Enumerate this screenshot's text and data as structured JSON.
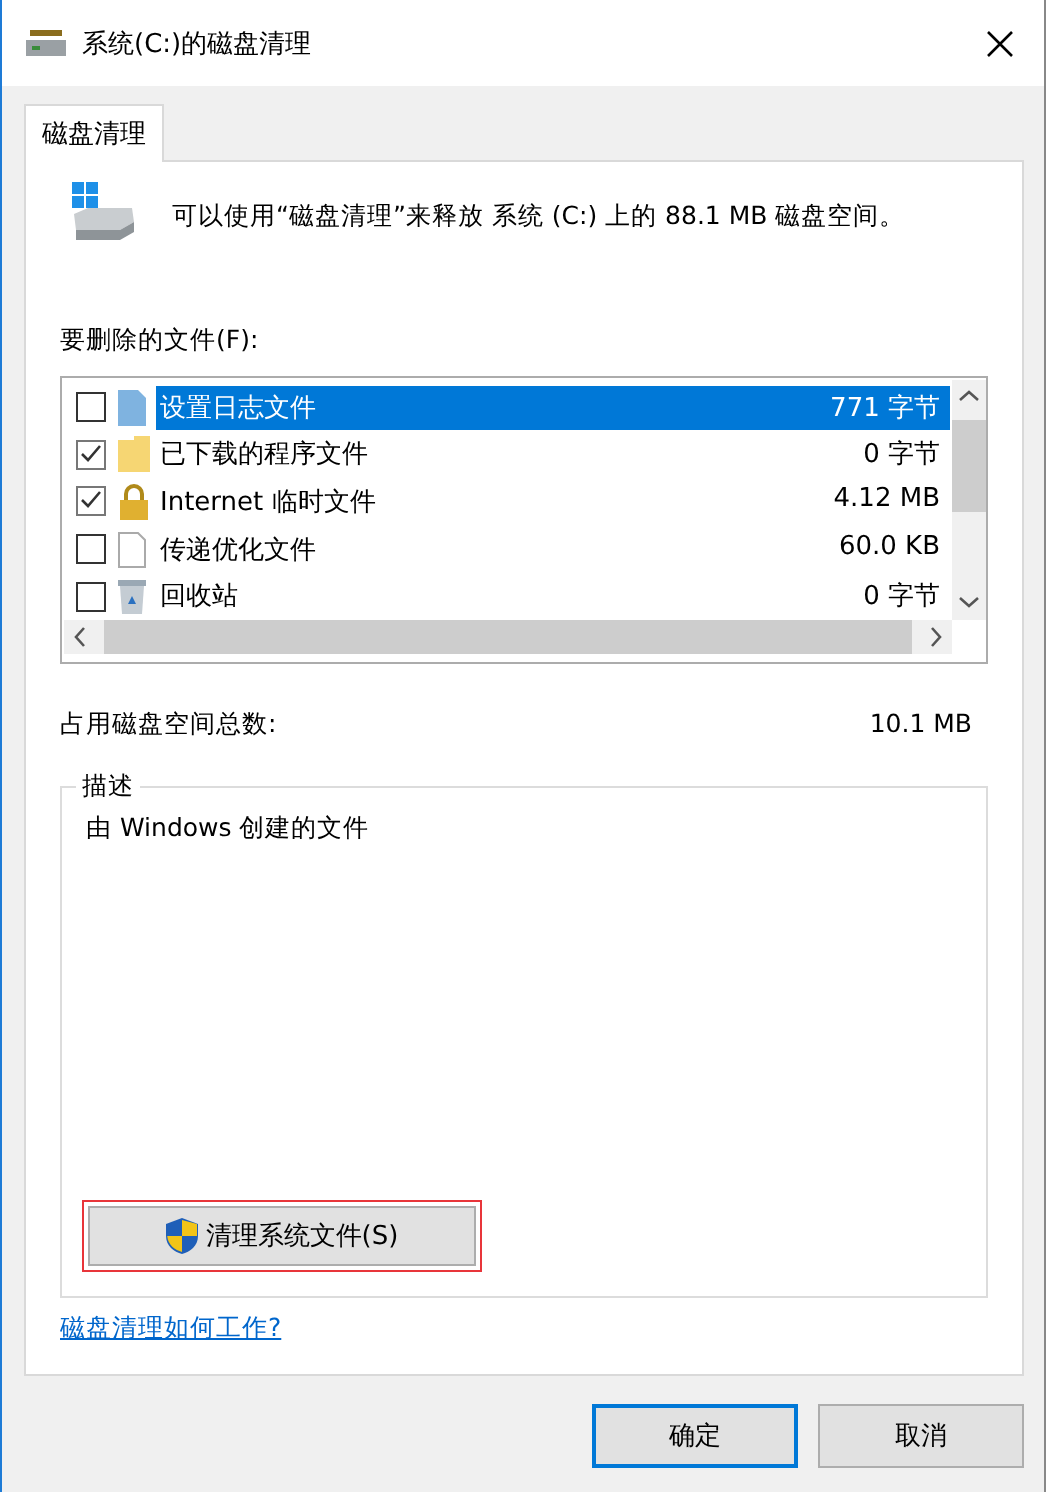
{
  "window": {
    "title": "系统(C:)的磁盘清理"
  },
  "tabs": [
    {
      "label": "磁盘清理",
      "selected": true
    }
  ],
  "intro": "可以使用“磁盘清理”来释放 系统 (C:) 上的 88.1 MB 磁盘空间。",
  "files_label": "要删除的文件(F):",
  "files": [
    {
      "name": "设置日志文件",
      "size": "771 字节",
      "checked": false,
      "selected": true,
      "kind": "log"
    },
    {
      "name": "已下载的程序文件",
      "size": "0 字节",
      "checked": true,
      "selected": false,
      "kind": "folder"
    },
    {
      "name": "Internet 临时文件",
      "size": "4.12 MB",
      "checked": true,
      "selected": false,
      "kind": "lock"
    },
    {
      "name": "传递优化文件",
      "size": "60.0 KB",
      "checked": false,
      "selected": false,
      "kind": "file"
    },
    {
      "name": "回收站",
      "size": "0 字节",
      "checked": false,
      "selected": false,
      "kind": "bin"
    }
  ],
  "total": {
    "label": "占用磁盘空间总数:",
    "value": "10.1 MB"
  },
  "description": {
    "title": "描述",
    "text": "由 Windows 创建的文件",
    "button": "清理系统文件(S)",
    "highlighted": true
  },
  "help_link": "磁盘清理如何工作?",
  "buttons": [
    {
      "label": "确定",
      "default": true
    },
    {
      "label": "取消",
      "default": false
    }
  ]
}
